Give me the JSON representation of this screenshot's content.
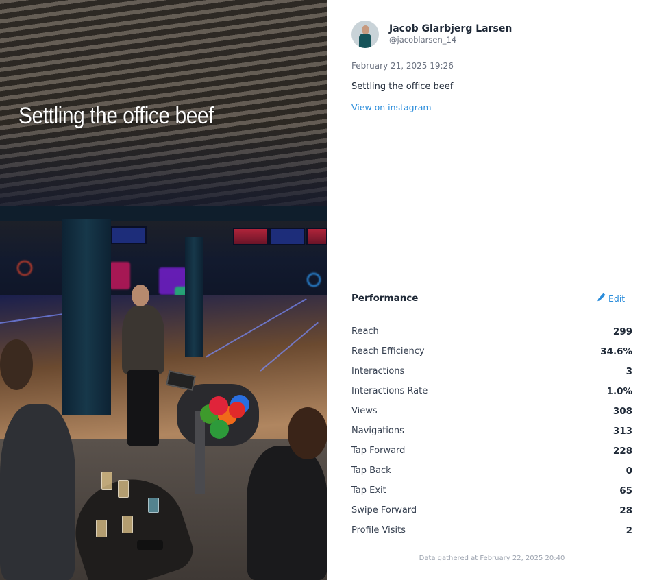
{
  "story": {
    "caption": "Settling the office beef"
  },
  "post": {
    "author_name": "Jacob Glarbjerg Larsen",
    "author_handle": "@jacoblarsen_14",
    "date": "February 21, 2025 19:26",
    "text": "Settling the office beef",
    "instagram_link": "View on instagram"
  },
  "performance": {
    "title": "Performance",
    "edit_label": "Edit",
    "metrics": [
      {
        "label": "Reach",
        "value": "299"
      },
      {
        "label": "Reach Efficiency",
        "value": "34.6%"
      },
      {
        "label": "Interactions",
        "value": "3"
      },
      {
        "label": "Interactions Rate",
        "value": "1.0%"
      },
      {
        "label": "Views",
        "value": "308"
      },
      {
        "label": "Navigations",
        "value": "313"
      },
      {
        "label": "Tap Forward",
        "value": "228"
      },
      {
        "label": "Tap Back",
        "value": "0"
      },
      {
        "label": "Tap Exit",
        "value": "65"
      },
      {
        "label": "Swipe Forward",
        "value": "28"
      },
      {
        "label": "Profile Visits",
        "value": "2"
      }
    ]
  },
  "footer": {
    "note": "Data gathered at February 22, 2025 20:40"
  },
  "colors": {
    "link": "#2b8ddb",
    "text_primary": "#1f2937",
    "text_muted": "#6b7280"
  },
  "icons": {
    "edit": "pencil-icon"
  }
}
